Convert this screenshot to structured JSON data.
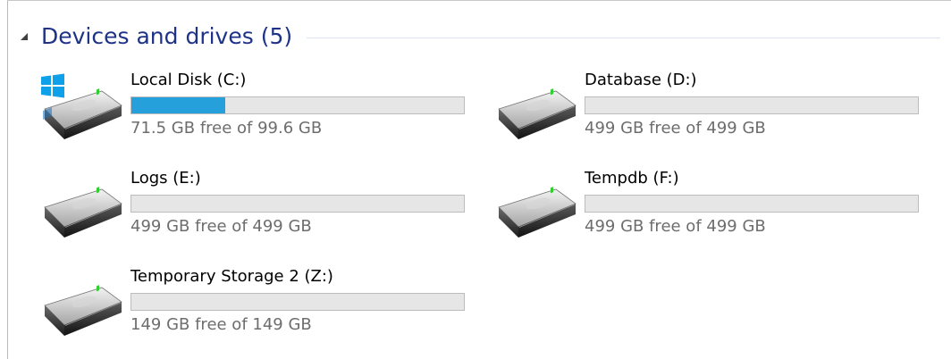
{
  "group": {
    "title": "Devices and drives (5)",
    "arrow_icon": "collapse-triangle-icon"
  },
  "colors": {
    "header_text": "#1e3287",
    "usage_bar_fill": "#26a0da",
    "free_text": "#6d6d6d"
  },
  "drives": [
    {
      "name": "Local Disk (C:)",
      "free_text": "71.5 GB free of 99.6 GB",
      "used_fraction": 0.282,
      "icon": "system-drive-icon"
    },
    {
      "name": "Database (D:)",
      "free_text": "499 GB free of 499 GB",
      "used_fraction": 0.0,
      "icon": "hard-drive-icon"
    },
    {
      "name": "Logs (E:)",
      "free_text": "499 GB free of 499 GB",
      "used_fraction": 0.0,
      "icon": "hard-drive-icon"
    },
    {
      "name": "Tempdb (F:)",
      "free_text": "499 GB free of 499 GB",
      "used_fraction": 0.0,
      "icon": "hard-drive-icon"
    },
    {
      "name": "Temporary Storage 2 (Z:)",
      "free_text": "149 GB free of 149 GB",
      "used_fraction": 0.0,
      "icon": "hard-drive-icon"
    }
  ]
}
